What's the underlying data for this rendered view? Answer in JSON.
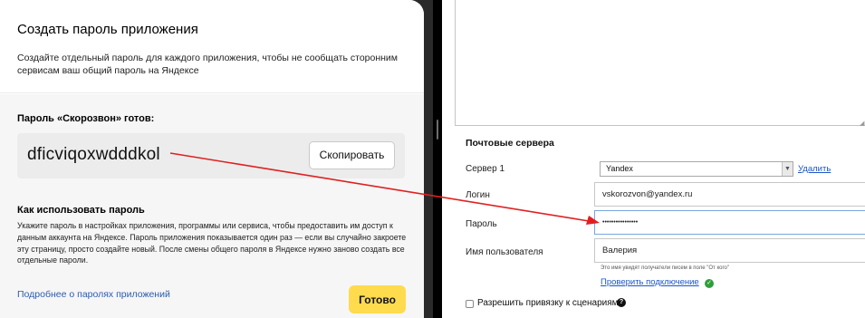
{
  "dialog": {
    "title": "Создать пароль приложения",
    "subtitle": "Создайте отдельный пароль для каждого приложения, чтобы не сообщать сторонним сервисам ваш общий пароль на Яндексе",
    "password_ready_label": "Пароль «Скорозвон» готов:",
    "password_value": "dficviqoxwdddkol",
    "copy_button": "Скопировать",
    "howto_title": "Как использовать пароль",
    "howto_text": "Укажите пароль в настройках приложения, программы или сервиса, чтобы предоставить им доступ к данным аккаунта на Яндексе. Пароль приложения показывается один раз — если вы случайно закроете эту страницу, просто создайте новый. После смены общего пароля в Яндексе нужно заново создать все отдельные пароли.",
    "more_link": "Подробнее о паролях приложений",
    "done_button": "Готово"
  },
  "mail_servers": {
    "title": "Почтовые сервера",
    "server_label": "Сервер 1",
    "server_value": "Yandex",
    "delete_link": "Удалить",
    "login_label": "Логин",
    "login_value": "vskorozvon@yandex.ru",
    "password_label": "Пароль",
    "password_masked": "••••••••••••••••",
    "username_label": "Имя пользователя",
    "username_value": "Валерия",
    "username_hint": "Это имя увидят получатели писем в поле \"От кого\"",
    "check_link": "Проверить подключение",
    "allow_label": "Разрешить привязку к сценариям"
  },
  "colors": {
    "accent_yellow": "#ffdb4d",
    "link_blue": "#1b56c8",
    "arrow_red": "#e02020",
    "success_green": "#2f9e3a"
  }
}
